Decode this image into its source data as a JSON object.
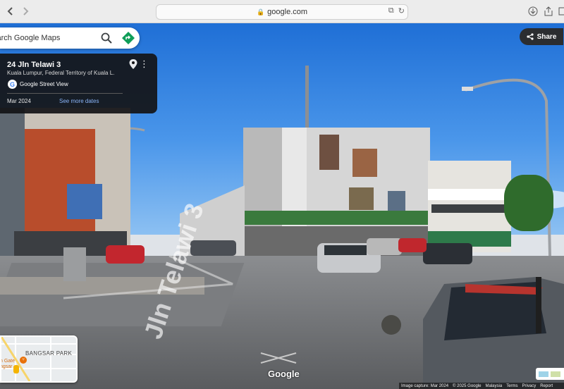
{
  "browser": {
    "address": "google.com",
    "back_icon": "chevron-left-icon",
    "forward_icon": "chevron-right-icon"
  },
  "search": {
    "placeholder": "Search Google Maps"
  },
  "info_card": {
    "title": "24 Jln Telawi 3",
    "subtitle": "Kuala Lumpur, Federal Territory of Kuala L...",
    "source": "Google Street View",
    "date": "Mar 2024",
    "more_dates": "See more dates"
  },
  "share": {
    "label": "Share"
  },
  "street_label": "Jln Telawi 3",
  "minimap": {
    "area_label": "BANGSAR PARK",
    "poi_label": "n Gate\nngsar"
  },
  "watermark": "Google",
  "footer": {
    "capture": "Image capture: Mar 2024",
    "copyright": "© 2025 Google",
    "country": "Malaysia",
    "terms": "Terms",
    "privacy": "Privacy",
    "report": "Report"
  },
  "colors": {
    "accent_link": "#8ab4f8",
    "card_bg": "#141416",
    "share_bg": "#2b2d30",
    "directions": "#0f9d58"
  }
}
